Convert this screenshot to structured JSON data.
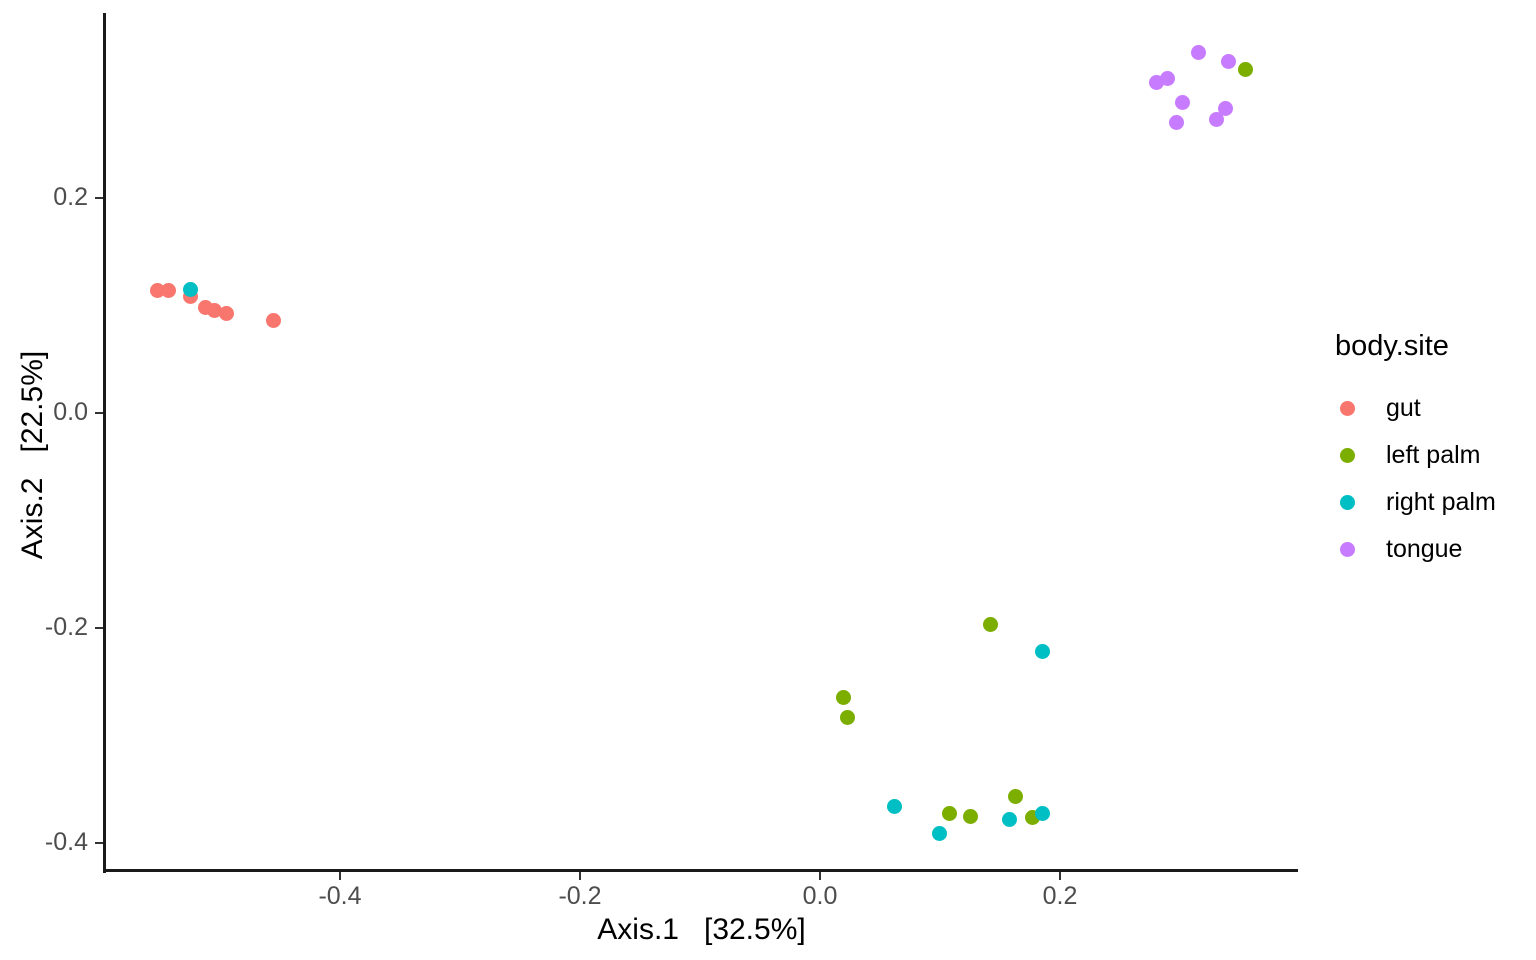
{
  "chart_data": {
    "type": "scatter",
    "title": "",
    "xlabel": "Axis.1   [32.5%]",
    "ylabel": "Axis.2   [22.5%]",
    "legend_title": "body.site",
    "legend_position": "right",
    "grid": false,
    "xlim": [
      -0.5985,
      0.3983
    ],
    "ylim": [
      -0.426,
      0.3721
    ],
    "xticks": [
      "-0.4",
      "-0.2",
      "0.0",
      "0.2"
    ],
    "xtick_values": [
      -0.4,
      -0.2,
      0.0,
      0.2
    ],
    "yticks": [
      "0.2",
      "0.0",
      "-0.2",
      "-0.4"
    ],
    "ytick_values": [
      0.2,
      0.0,
      -0.2,
      -0.4
    ],
    "colors": {
      "gut": "#F8766D",
      "left palm": "#7CAE00",
      "right palm": "#00BFC4",
      "tongue": "#C77CFF"
    },
    "series": [
      {
        "name": "gut",
        "color": "#F8766D",
        "points": [
          [
            -0.5525,
            0.1144
          ],
          [
            -0.5433,
            0.1144
          ],
          [
            -0.525,
            0.1088
          ],
          [
            -0.5125,
            0.0977
          ],
          [
            -0.5042,
            0.0958
          ],
          [
            -0.4942,
            0.093
          ],
          [
            -0.4558,
            0.0856
          ]
        ]
      },
      {
        "name": "left palm",
        "color": "#7CAE00",
        "points": [
          [
            0.1417,
            -0.1963
          ],
          [
            0.0192,
            -0.2642
          ],
          [
            0.0225,
            -0.2828
          ],
          [
            0.1075,
            -0.373
          ],
          [
            0.125,
            -0.3749
          ],
          [
            0.1625,
            -0.3563
          ],
          [
            0.1767,
            -0.3767
          ],
          [
            0.3542,
            0.32
          ]
        ]
      },
      {
        "name": "right palm",
        "color": "#00BFC4",
        "points": [
          [
            -0.5242,
            0.1153
          ],
          [
            0.185,
            -0.2214
          ],
          [
            0.0617,
            -0.3665
          ],
          [
            0.0992,
            -0.3907
          ],
          [
            0.1583,
            -0.3786
          ],
          [
            0.185,
            -0.3721
          ]
        ]
      },
      {
        "name": "tongue",
        "color": "#C77CFF",
        "points": [
          [
            0.3158,
            0.3349
          ],
          [
            0.34,
            0.3274
          ],
          [
            0.2808,
            0.3079
          ],
          [
            0.2892,
            0.3107
          ],
          [
            0.3017,
            0.2893
          ],
          [
            0.3383,
            0.2828
          ],
          [
            0.33,
            0.2726
          ],
          [
            0.2967,
            0.2698
          ]
        ]
      }
    ]
  },
  "legend": {
    "title": "body.site",
    "entries": [
      {
        "label": "gut",
        "color": "#F8766D"
      },
      {
        "label": "left palm",
        "color": "#7CAE00"
      },
      {
        "label": "right palm",
        "color": "#00BFC4"
      },
      {
        "label": "tongue",
        "color": "#C77CFF"
      }
    ]
  },
  "axes": {
    "x_title": "Axis.1   [32.5%]",
    "y_title": "Axis.2   [22.5%]"
  }
}
